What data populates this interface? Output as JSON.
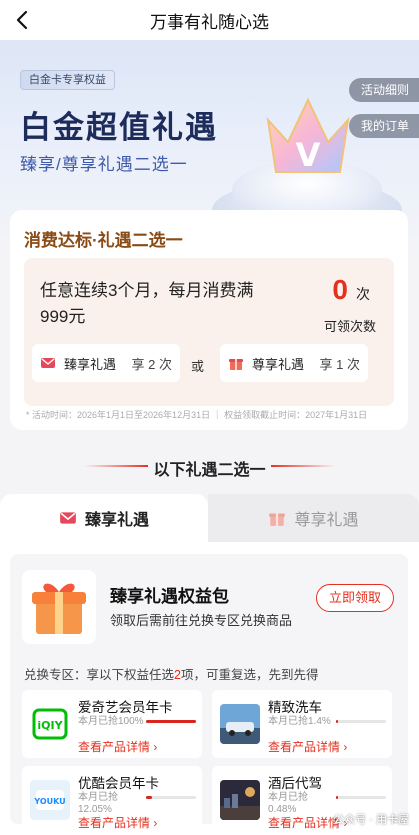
{
  "nav": {
    "title": "万事有礼随心选"
  },
  "hero": {
    "tag": "白金卡专享权益",
    "title": "白金超值礼遇",
    "subtitle": "臻享/尊享礼遇二选一",
    "activity_rules": "活动细则",
    "my_orders": "我的订单"
  },
  "spend_card": {
    "title_prefix": "消费达标·",
    "title_highlight": "礼遇二选一",
    "condition": "任意连续3个月，每月消费满999元",
    "count": "0",
    "count_unit": "次",
    "count_label": "可领次数",
    "option1": {
      "label": "臻享礼遇",
      "times": "享 2 次"
    },
    "or": "或",
    "option2": {
      "label": "尊享礼遇",
      "times": "享 1 次"
    },
    "note": "* 活动时间：2026年1月1日至2026年12月31日 ｜ 权益领取截止时间：2027年1月31日"
  },
  "section_title": "以下礼遇二选一",
  "tabs": [
    {
      "label": "臻享礼遇",
      "active": true
    },
    {
      "label": "尊享礼遇",
      "active": false
    }
  ],
  "package": {
    "name": "臻享礼遇权益包",
    "desc": "领取后需前往兑换专区兑换商品",
    "claim_button": "立即领取",
    "rule_prefix": "兑换专区：享以下权益任选",
    "rule_num": "2",
    "rule_suffix": "项，可重复选，先到先得",
    "items": [
      {
        "name": "爱奇艺会员年卡",
        "pct_text": "本月已抢100%",
        "pct": 1.0,
        "link": "查看产品详情 ›",
        "thumb": "iqiyi-logo"
      },
      {
        "name": "精致洗车",
        "pct_text": "本月已抢1.4%",
        "pct": 0.014,
        "link": "查看产品详情 ›",
        "thumb": "car-wash-photo"
      },
      {
        "name": "优酷会员年卡",
        "pct_text": "本月已抢12.05%",
        "pct": 0.1205,
        "link": "查看产品详情 ›",
        "thumb": "youku-logo"
      },
      {
        "name": "酒后代驾",
        "pct_text": "本月已抢0.48%",
        "pct": 0.0048,
        "link": "查看产品详情 ›",
        "thumb": "designated-driver-photo"
      }
    ]
  },
  "watermark": "公众号 · 用卡屋",
  "colors": {
    "accent": "#e5301f",
    "hero_title": "#1d2c5a",
    "gold_title": "#8a4b14"
  }
}
